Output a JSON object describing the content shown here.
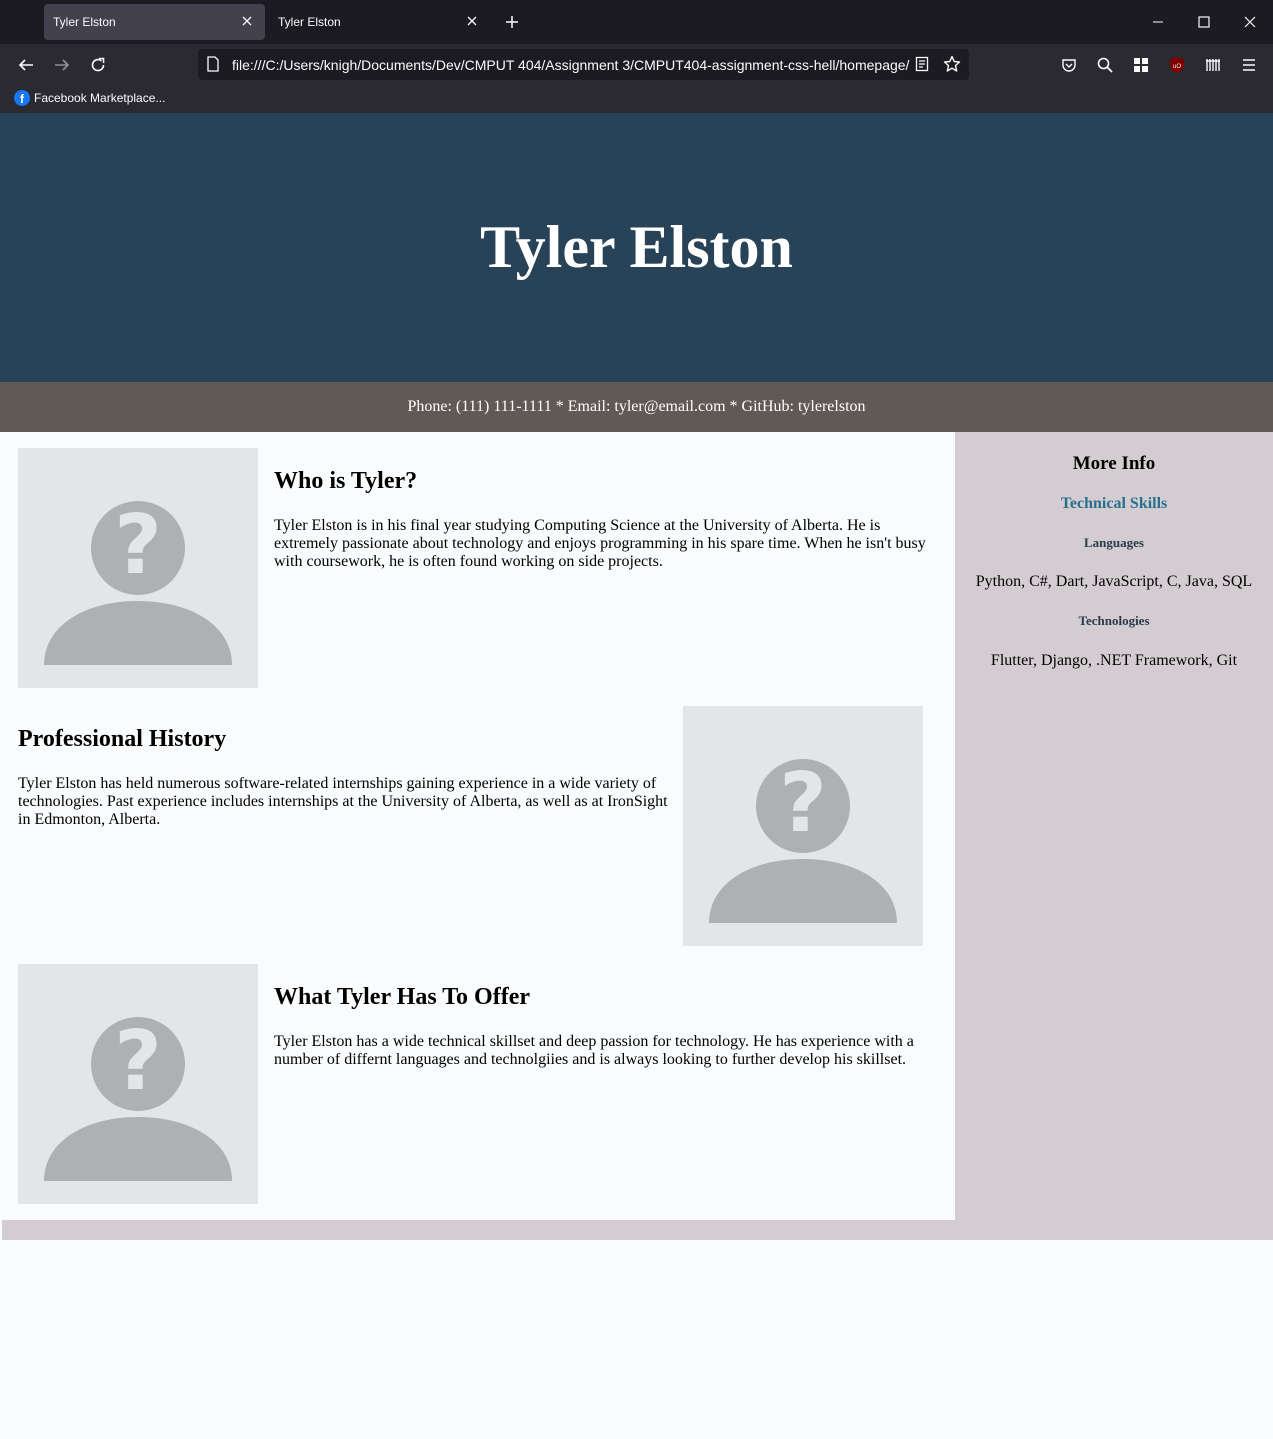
{
  "browser": {
    "tabs": [
      {
        "title": "Tyler Elston",
        "active": true
      },
      {
        "title": "Tyler Elston",
        "active": false
      }
    ],
    "url": "file:///C:/Users/knigh/Documents/Dev/CMPUT 404/Assignment 3/CMPUT404-assignment-css-hell/homepage/",
    "bookmarks": [
      {
        "label": "Facebook Marketplace...",
        "icon": "facebook-icon"
      }
    ]
  },
  "header": {
    "name": "Tyler Elston",
    "contact": "Phone: (111) 111-1111 * Email: tyler@email.com * GitHub: tylerelston"
  },
  "sections": [
    {
      "title": "Who is Tyler?",
      "text": "Tyler Elston is in his final year studying Computing Science at the University of Alberta. He is extremely passionate about technology and enjoys programming in his spare time. When he isn't busy with coursework, he is often found working on side projects."
    },
    {
      "title": "Professional History",
      "text": "Tyler Elston has held numerous software-related internships gaining experience in a wide variety of technologies. Past experience includes internships at the University of Alberta, as well as at IronSight in Edmonton, Alberta."
    },
    {
      "title": "What Tyler Has To Offer",
      "text": "Tyler Elston has a wide technical skillset and deep passion for technology. He has experience with a number of differnt languages and technolgiies and is always looking to further develop his skillset."
    }
  ],
  "sidebar": {
    "title": "More Info",
    "skills_heading": "Technical Skills",
    "languages_heading": "Languages",
    "languages": "Python, C#, Dart, JavaScript, C, Java, SQL",
    "technologies_heading": "Technologies",
    "technologies": "Flutter, Django, .NET Framework, Git"
  },
  "colors": {
    "hero_bg": "#284358",
    "contact_bg": "#615956",
    "sidebar_bg": "#d3cdd1",
    "skills_heading": "#2a6f8f"
  }
}
